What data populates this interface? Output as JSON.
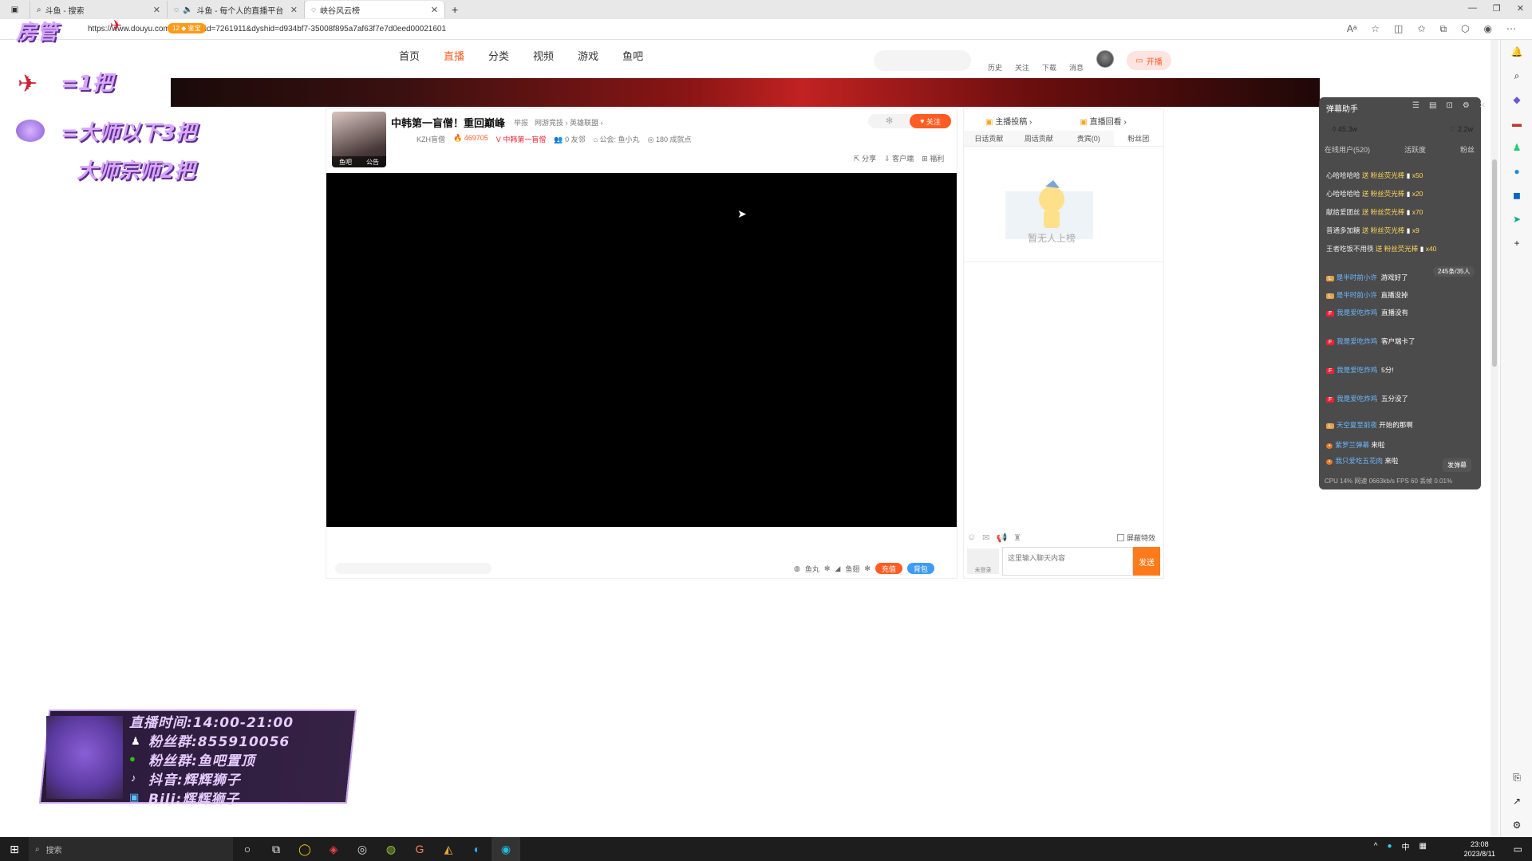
{
  "browser": {
    "tabs": [
      {
        "label": "斗鱼 - 搜索",
        "icon": "search-icon"
      },
      {
        "label": "斗鱼 - 每个人的直播平台",
        "icon": "speaker-icon"
      },
      {
        "label": "峡谷风云榜",
        "icon": "douyu-icon"
      }
    ],
    "url": "https://www.douyu.com/topic/...?rid=7261911&dyshid=d934bf7-35008f895a7af63f7e7d0eed00021601"
  },
  "site": {
    "nav": [
      "首页",
      "直播",
      "分类",
      "视频",
      "游戏",
      "鱼吧"
    ],
    "nav_active": "直播",
    "links": [
      "历史",
      "关注",
      "下载",
      "消息"
    ],
    "kaibo": "开播"
  },
  "overlay": {
    "room_label": "房管",
    "rocket_rule": "=1把",
    "diamond_rule1": "=大师以下3把",
    "diamond_rule2": "大师宗师2把"
  },
  "room": {
    "title": "中韩第一盲僧！重回巅峰",
    "report": "举报",
    "category": "网游竞技 › 英雄联盟 ›",
    "anchor": "KZH盲僧",
    "hot": "469705",
    "badge": "中韩第一盲僧",
    "fans": "0 友邻",
    "guild": "公会: 鱼小丸",
    "level": "180 成就点",
    "avatar_labels": [
      "鱼吧",
      "公告"
    ],
    "follow": "关注",
    "tools": [
      "分享",
      "客户端",
      "福利"
    ]
  },
  "gifts_bar": {
    "yuwan": "鱼丸",
    "yuchi": "鱼翅",
    "recharge": "充值",
    "backpack": "背包"
  },
  "rank": {
    "links": [
      "主播投稿 ›",
      "直播回看 ›"
    ],
    "tabs": [
      "日话贡献",
      "周话贡献",
      "贵宾(0)",
      "粉丝团"
    ],
    "empty": "暂无人上榜",
    "block_effects": "屏蔽特效",
    "input_placeholder": "这里输入聊天内容",
    "avatar_label": "未登录",
    "send": "发送"
  },
  "assistant": {
    "title": "弹幕助手",
    "popularity": "45.3w",
    "likes": "2.2w",
    "tabs": [
      "在线用户(520)",
      "活跃度",
      "粉丝"
    ],
    "gifts": [
      {
        "user": "心哈哈哈哈",
        "action": "送 粉丝荧光棒",
        "count": "x50"
      },
      {
        "user": "心哈哈哈哈",
        "action": "送 粉丝荧光棒",
        "count": "x20"
      },
      {
        "user": "献给爱团丝",
        "action": "送 粉丝荧光棒",
        "count": "x70"
      },
      {
        "user": "普通多加糖",
        "action": "送 粉丝荧光棒",
        "count": "x9"
      },
      {
        "user": "王者吃饭不用筷",
        "action": "送 粉丝荧光棒",
        "count": "x40"
      }
    ],
    "count_badge": "245条/35人",
    "messages": [
      {
        "user": "是半时前小许",
        "text": "游戏好了"
      },
      {
        "user": "是半时前小许",
        "text": "直播没掉"
      },
      {
        "user": "我是爱吃炸鸡",
        "text": "直播没有"
      },
      {
        "user": "我是爱吃炸鸡",
        "text": "客户端卡了"
      },
      {
        "user": "我是爱吃炸鸡",
        "text": "5分!"
      },
      {
        "user": "我是爱吃炸鸡",
        "text": "五分没了"
      },
      {
        "user": "天空夏至前夜",
        "text": "开始的那啊"
      },
      {
        "user": "紫罗兰弹幕",
        "text": "来啦"
      },
      {
        "user": "我只爱吃五花肉",
        "text": "来啦"
      }
    ],
    "send_btn": "发弹幕",
    "footer": "CPU 14% 网速 0663kb/s FPS 60 丢帧 0.01%"
  },
  "info_card": {
    "line1": "直播时间:14:00-21:00",
    "line2": "粉丝群:855910056",
    "line3": "粉丝群:鱼吧置顶",
    "line4": "抖音:辉辉狮子",
    "line5": "Bili:辉辉狮子"
  },
  "taskbar": {
    "search": "搜索",
    "ime": "中",
    "time": "23:08",
    "date": "2023/8/11"
  }
}
